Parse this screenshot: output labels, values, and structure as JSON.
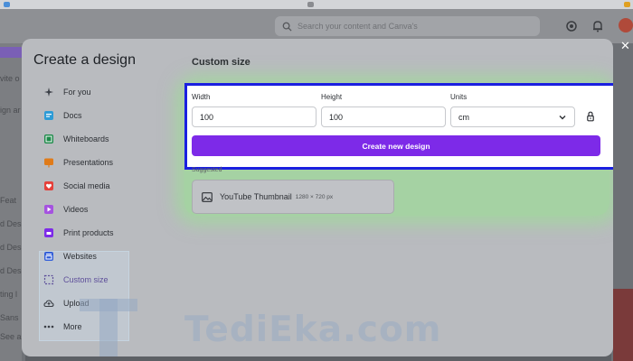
{
  "header": {
    "search_placeholder": "Search your content and Canva's"
  },
  "background_sidebar": [
    "vite o",
    "ign ar",
    "Feat",
    "d Desi",
    "d Desi",
    "d Desi",
    "ting l",
    "Sans",
    "See al"
  ],
  "modal": {
    "title": "Create a design",
    "close_icon": "close-icon",
    "nav": [
      {
        "label": "For you",
        "icon": "sparkle-icon",
        "color": "#3b3f46"
      },
      {
        "label": "Docs",
        "icon": "doc-icon",
        "color": "#2d9bd6"
      },
      {
        "label": "Whiteboards",
        "icon": "whiteboard-icon",
        "color": "#1e8a4a"
      },
      {
        "label": "Presentations",
        "icon": "presentation-icon",
        "color": "#e07b19"
      },
      {
        "label": "Social media",
        "icon": "heart-icon",
        "color": "#e5403a"
      },
      {
        "label": "Videos",
        "icon": "video-icon",
        "color": "#a552e0"
      },
      {
        "label": "Print products",
        "icon": "print-icon",
        "color": "#7d2ae8"
      },
      {
        "label": "Websites",
        "icon": "website-icon",
        "color": "#3560d8"
      },
      {
        "label": "Custom size",
        "icon": "custom-size-icon",
        "color": "#5e4f9a"
      },
      {
        "label": "Upload",
        "icon": "upload-cloud-icon",
        "color": "#3b3f46"
      },
      {
        "label": "More",
        "icon": "more-icon",
        "color": "#3b3f46"
      }
    ],
    "active_nav": "Custom size",
    "section_title": "Custom size",
    "width_label": "Width",
    "width_value": "100",
    "height_label": "Height",
    "height_value": "100",
    "units_label": "Units",
    "units_value": "cm",
    "create_button": "Create new design",
    "suggested_label": "Suggested",
    "suggestion": {
      "name": "YouTube Thumbnail",
      "dimensions": "1280 × 720 px"
    }
  },
  "watermark": "TediEka.com",
  "colors": {
    "accent": "#7d2ae8",
    "highlight_border": "#1a1fe0",
    "glow": "#96e68c"
  }
}
